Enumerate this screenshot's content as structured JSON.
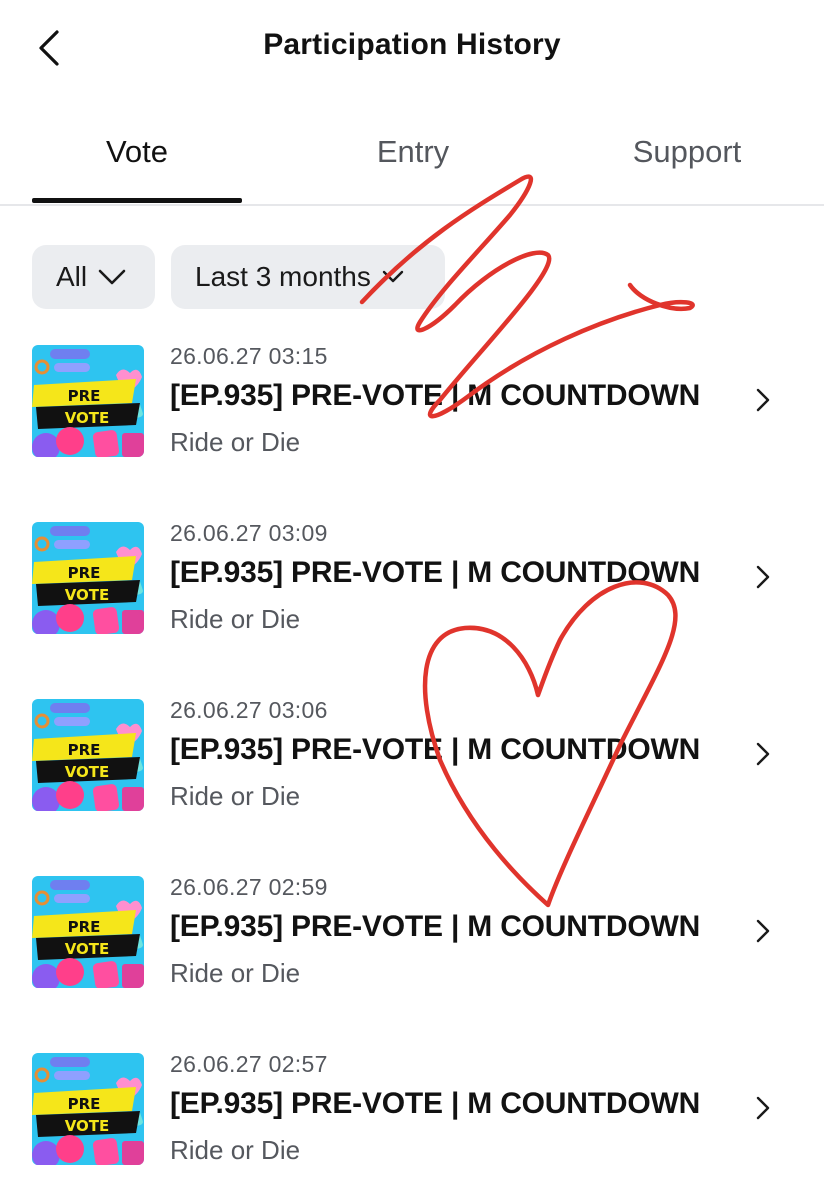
{
  "header": {
    "title": "Participation History",
    "back_icon": "chevron-left-icon"
  },
  "tabs": [
    {
      "label": "Vote",
      "active": true
    },
    {
      "label": "Entry",
      "active": false
    },
    {
      "label": "Support",
      "active": false
    }
  ],
  "filters": {
    "type": {
      "value": "All",
      "icon": "chevron-down-icon"
    },
    "period": {
      "value": "Last 3 months",
      "icon": "chevron-down-icon"
    }
  },
  "items": [
    {
      "date": "26.06.27 03:15",
      "title": "[EP.935] PRE-VOTE | M COUNTDOWN",
      "artist": "Ride or Die",
      "thumbnail_text": [
        "PRE",
        "VOTE"
      ]
    },
    {
      "date": "26.06.27 03:09",
      "title": "[EP.935] PRE-VOTE | M COUNTDOWN",
      "artist": "Ride or Die",
      "thumbnail_text": [
        "PRE",
        "VOTE"
      ]
    },
    {
      "date": "26.06.27 03:06",
      "title": "[EP.935] PRE-VOTE | M COUNTDOWN",
      "artist": "Ride or Die",
      "thumbnail_text": [
        "PRE",
        "VOTE"
      ]
    },
    {
      "date": "26.06.27 02:59",
      "title": "[EP.935] PRE-VOTE | M COUNTDOWN",
      "artist": "Ride or Die",
      "thumbnail_text": [
        "PRE",
        "VOTE"
      ]
    },
    {
      "date": "26.06.27 02:57",
      "title": "[EP.935] PRE-VOTE | M COUNTDOWN",
      "artist": "Ride or Die",
      "thumbnail_text": [
        "PRE",
        "VOTE"
      ]
    }
  ],
  "colors": {
    "accent": "#111111",
    "filter_bg": "#ebedf0",
    "secondary_text": "#55585e",
    "scribble": "#e0342c",
    "thumb_bg": "#2ec4f0",
    "thumb_banner": "#f5e61a"
  }
}
